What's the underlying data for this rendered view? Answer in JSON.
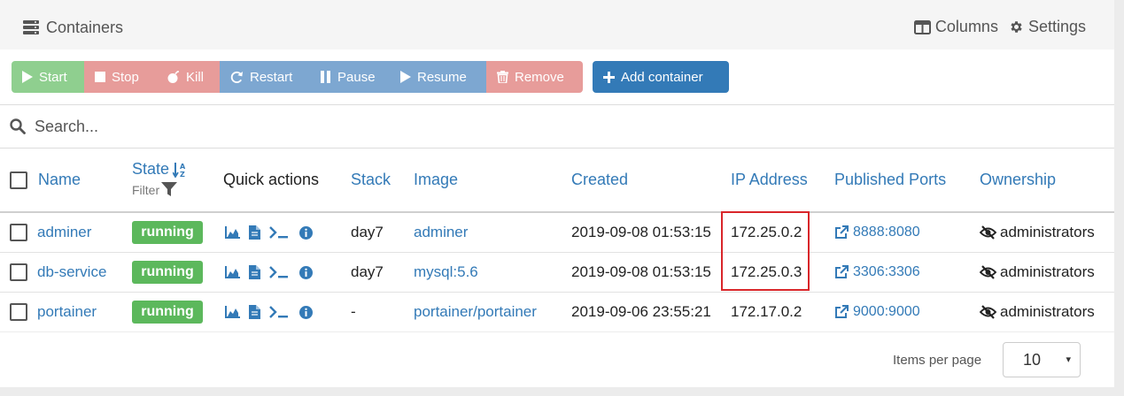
{
  "header": {
    "title": "Containers",
    "columns_label": "Columns",
    "settings_label": "Settings"
  },
  "toolbar": {
    "start": "Start",
    "stop": "Stop",
    "kill": "Kill",
    "restart": "Restart",
    "pause": "Pause",
    "resume": "Resume",
    "remove": "Remove",
    "add": "Add container"
  },
  "search": {
    "placeholder": "Search..."
  },
  "table": {
    "headers": {
      "name": "Name",
      "state": "State",
      "state_filter": "Filter",
      "quick_actions": "Quick actions",
      "stack": "Stack",
      "image": "Image",
      "created": "Created",
      "ip": "IP Address",
      "ports": "Published Ports",
      "ownership": "Ownership"
    },
    "rows": [
      {
        "name": "adminer",
        "state": "running",
        "stack": "day7",
        "image": "adminer",
        "created": "2019-09-08 01:53:15",
        "ip": "172.25.0.2",
        "ports": "8888:8080",
        "ownership": "administrators"
      },
      {
        "name": "db-service",
        "state": "running",
        "stack": "day7",
        "image": "mysql:5.6",
        "created": "2019-09-08 01:53:15",
        "ip": "172.25.0.3",
        "ports": "3306:3306",
        "ownership": "administrators"
      },
      {
        "name": "portainer",
        "state": "running",
        "stack": "-",
        "image": "portainer/portainer",
        "created": "2019-09-06 23:55:21",
        "ip": "172.17.0.2",
        "ports": "9000:9000",
        "ownership": "administrators"
      }
    ]
  },
  "pagination": {
    "items_per_page_label": "Items per page",
    "items_per_page": "10"
  },
  "icons": {
    "title": "server-icon",
    "columns": "columns-icon",
    "settings": "gear-icon",
    "search": "search-icon",
    "stats": "area-chart-icon",
    "logs": "file-icon",
    "console": "terminal-icon",
    "inspect": "info-icon",
    "port": "external-link-icon",
    "ownership": "eye-slash-icon"
  },
  "colors": {
    "accent": "#337ab7",
    "running": "#5cb85c",
    "start": "#8fcf8f",
    "danger": "#e79c9a",
    "neutral": "#7da7d1",
    "highlight": "#d9262a"
  }
}
